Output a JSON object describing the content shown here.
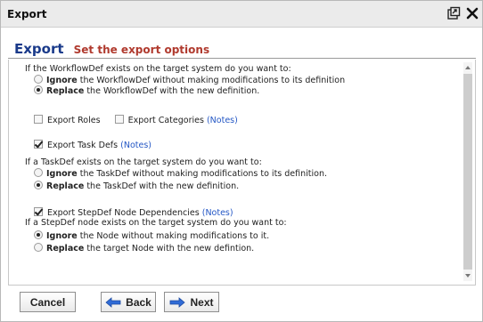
{
  "window": {
    "title": "Export",
    "maximize_icon": "maximize-icon",
    "close_icon": "close-icon"
  },
  "header": {
    "title": "Export",
    "subtitle": "Set the export options"
  },
  "workflow": {
    "question": "If the WorkflowDef exists on the target system do you want to:",
    "options": [
      {
        "bold": "Ignore",
        "text": " the WorkflowDef without making modifications to its definition",
        "checked": false
      },
      {
        "bold": "Replace",
        "text": " the WorkflowDef with the new definition.",
        "checked": true
      }
    ]
  },
  "checkboxes": {
    "export_roles": {
      "label": "Export Roles",
      "checked": false
    },
    "export_categories": {
      "label": "Export Categories",
      "checked": false,
      "notes": "(Notes)"
    },
    "export_task_defs": {
      "label": "Export Task Defs",
      "checked": true,
      "notes": "(Notes)"
    },
    "export_stepdef_deps": {
      "label": "Export StepDef Node Dependencies",
      "checked": true,
      "notes": "(Notes)"
    }
  },
  "taskdef": {
    "question": "If a TaskDef exists on the target system do you want to:",
    "options": [
      {
        "bold": "Ignore",
        "text": " the TaskDef without making modifications to its definition.",
        "checked": false
      },
      {
        "bold": "Replace",
        "text": " the TaskDef with the new definition.",
        "checked": true
      }
    ]
  },
  "stepdef": {
    "question": "If a StepDef node exists on the target system do you want to:",
    "options": [
      {
        "bold": "Ignore",
        "text": " the Node without making modifications to it.",
        "checked": true
      },
      {
        "bold": "Replace",
        "text": " the target Node with the new defintion.",
        "checked": false
      }
    ]
  },
  "footer": {
    "cancel_label": "Cancel",
    "back_label": "Back",
    "next_label": "Next"
  },
  "colors": {
    "header_title": "#1a3a8a",
    "header_subtitle": "#b03a2e",
    "link": "#2457c5",
    "arrow_blue": "#2f6bd6"
  }
}
